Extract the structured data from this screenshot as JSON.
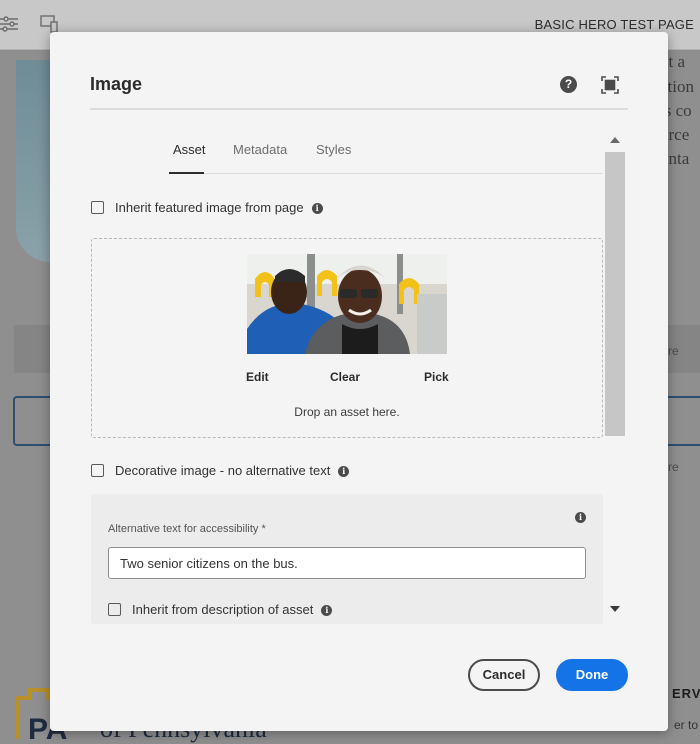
{
  "background": {
    "page_title": "BASIC HERO TEST PAGE",
    "right_text_lines": [
      "nt a",
      "ation",
      "is co",
      "orce",
      "unta"
    ],
    "right_labels": [
      "re",
      "re"
    ],
    "footer_label": "ERVI",
    "footer_sub": "er to",
    "logo_word": "of Pennsylvania",
    "logo_letters": "PA"
  },
  "dialog": {
    "title": "Image",
    "help_glyph": "?",
    "tabs": [
      {
        "label": "Asset",
        "active": true
      },
      {
        "label": "Metadata",
        "active": false
      },
      {
        "label": "Styles",
        "active": false
      }
    ],
    "inherit_featured": {
      "label": "Inherit featured image from page",
      "checked": false
    },
    "asset": {
      "actions": [
        "Edit",
        "Clear",
        "Pick"
      ],
      "drop_hint": "Drop an asset here."
    },
    "decorative": {
      "label": "Decorative image - no alternative text",
      "checked": false
    },
    "alt_text": {
      "label": "Alternative text for accessibility *",
      "value": "Two senior citizens on the bus."
    },
    "inherit_description": {
      "label": "Inherit from description of asset",
      "checked": false
    },
    "buttons": {
      "cancel": "Cancel",
      "done": "Done"
    },
    "accent_color": "#1473e6"
  },
  "info_glyph": "i"
}
